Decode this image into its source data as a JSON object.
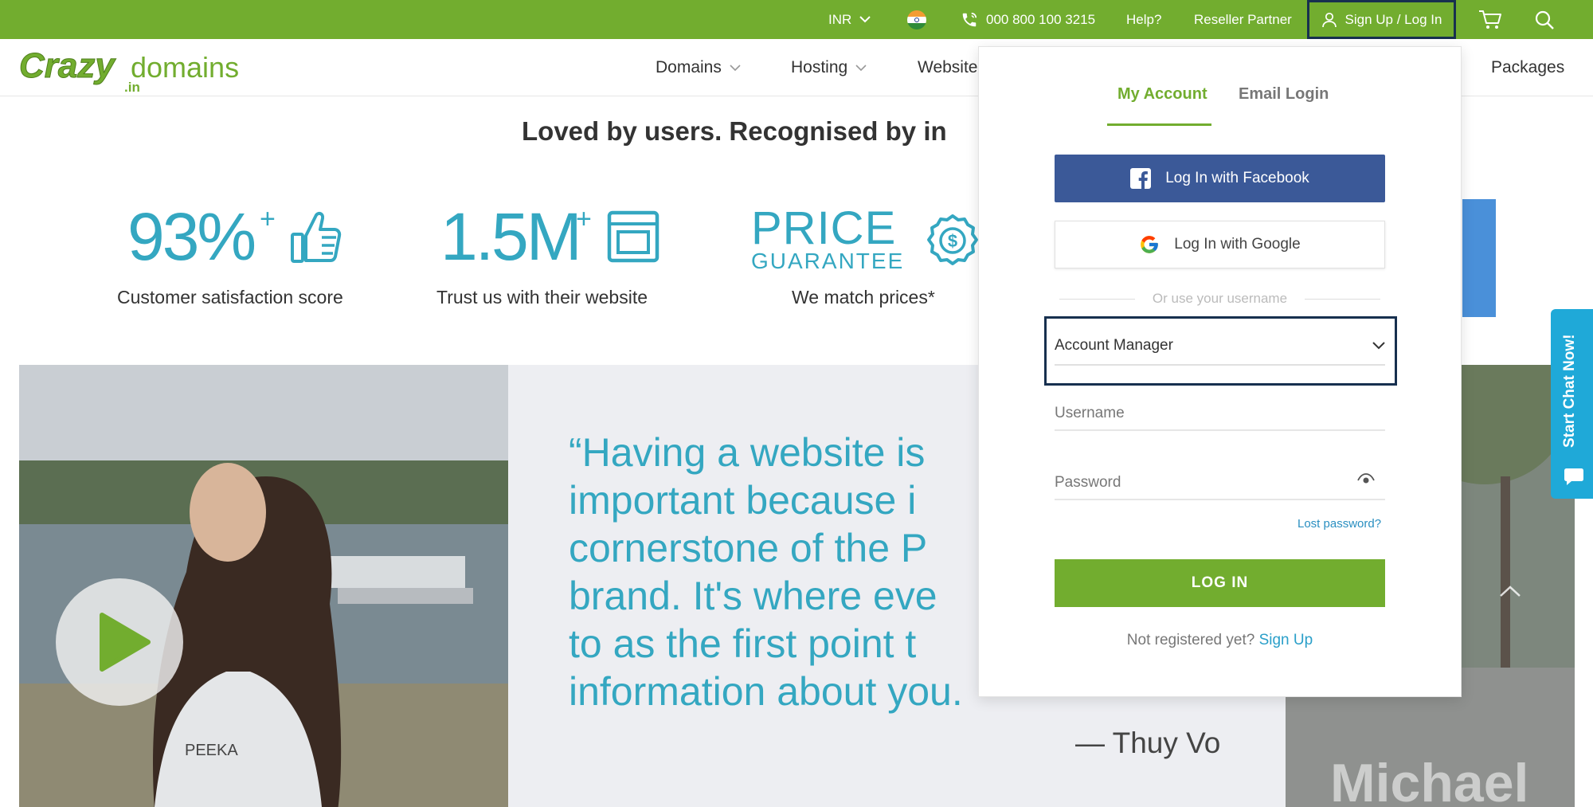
{
  "topbar": {
    "currency": "INR",
    "phone": "000 800 100 3215",
    "help": "Help?",
    "reseller": "Reseller Partner",
    "signin": "Sign Up / Log In",
    "flag_icon": "india-flag-icon",
    "cart_icon": "cart-icon",
    "search_icon": "search-icon"
  },
  "nav": {
    "logo_main": "Crazy",
    "logo_sub": "domains",
    "logo_tld": ".in",
    "items": [
      "Domains",
      "Hosting",
      "Website",
      "Packages"
    ]
  },
  "stats": {
    "heading": "Loved by users. Recognised by in",
    "items": [
      {
        "big": "93%",
        "sup": "+",
        "caption": "Customer satisfaction score"
      },
      {
        "big": "1.5M",
        "sup": "+",
        "caption": "Trust us with their website"
      }
    ],
    "price_top": "PRICE",
    "price_bottom": "GUARANTEE",
    "price_caption": "We match prices*"
  },
  "testimonial": {
    "lines": [
      "“Having a website is",
      "important because i",
      "cornerstone of the P",
      "brand. It's where eve",
      "to as the first point t",
      "information about you."
    ],
    "author": "— Thuy Vo",
    "right_name": "Michael",
    "shirt_text": "PEEKA"
  },
  "chat": {
    "label": "Start Chat Now!"
  },
  "login": {
    "tab_account": "My Account",
    "tab_email": "Email Login",
    "facebook": "Log In with Facebook",
    "google": "Log In with Google",
    "divider": "Or use your username",
    "account_select": "Account Manager",
    "username_placeholder": "Username",
    "password_placeholder": "Password",
    "lost_password": "Lost password?",
    "login_button": "LOG IN",
    "not_registered": "Not registered yet?",
    "sign_up": "Sign Up"
  },
  "colors": {
    "brand_green": "#72ad2f",
    "accent_teal": "#34a7c1",
    "facebook_blue": "#3b5998",
    "chat_blue": "#1fa9d8",
    "focus_navy": "#17304f"
  }
}
